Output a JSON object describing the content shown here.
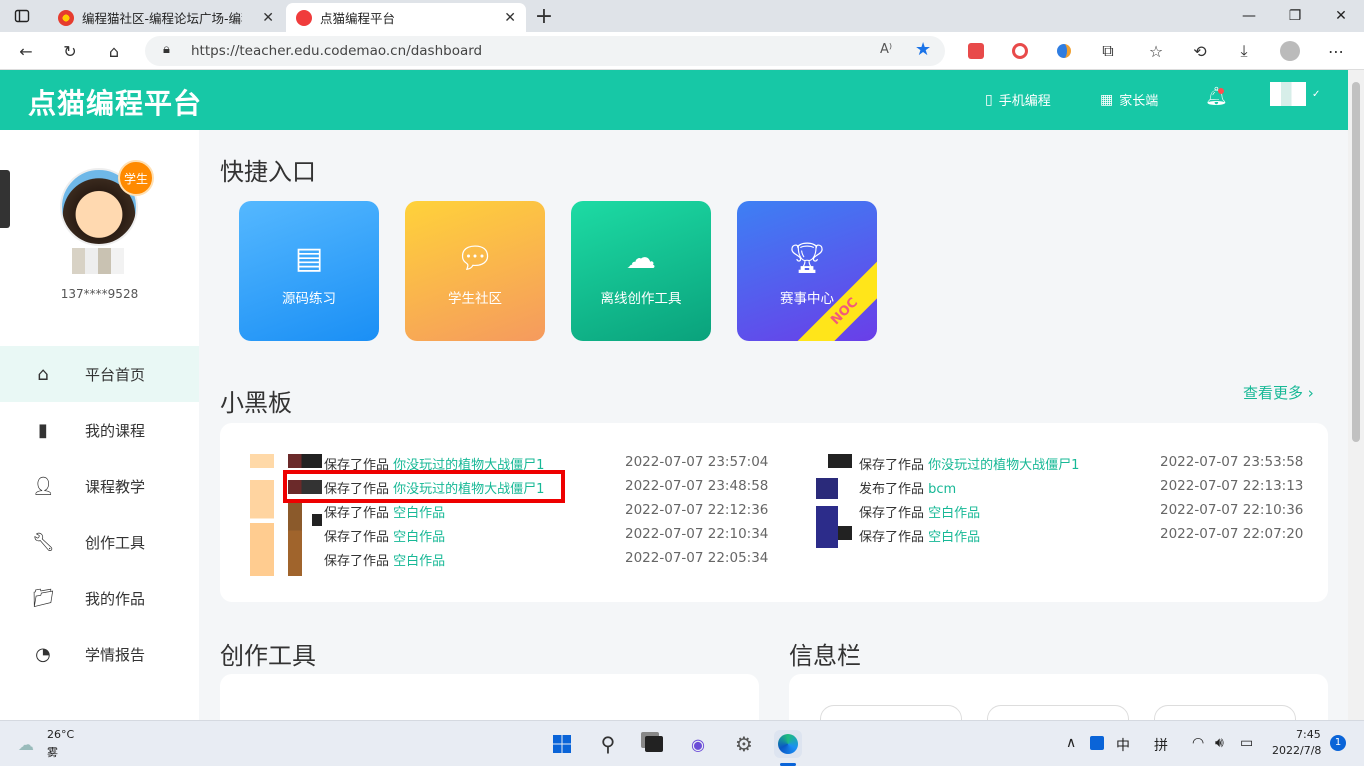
{
  "browser": {
    "tabs": [
      {
        "label": "编程猫社区-编程论坛广场-编程爱",
        "active": false
      },
      {
        "label": "点猫编程平台",
        "active": true
      }
    ],
    "url": "https://teacher.edu.codemao.cn/dashboard",
    "icons": [
      "sidebar-toggle-icon",
      "back-icon",
      "reload-icon",
      "home-icon",
      "lock-icon",
      "read-aloud-icon",
      "favorite-star-icon",
      "extension-icon",
      "collections-icon",
      "history-icon",
      "download-icon",
      "profile-icon",
      "more-icon"
    ]
  },
  "header": {
    "logo": "点猫编程平台",
    "mobile": "手机编程",
    "parent": "家长端"
  },
  "sidebar": {
    "badge": "学生",
    "phone": "137****9528",
    "items": [
      {
        "label": "平台首页",
        "icon": "home-icon",
        "active": true
      },
      {
        "label": "我的课程",
        "icon": "book-icon",
        "active": false
      },
      {
        "label": "课程教学",
        "icon": "teacher-icon",
        "active": false
      },
      {
        "label": "创作工具",
        "icon": "wrench-icon",
        "active": false
      },
      {
        "label": "我的作品",
        "icon": "folder-icon",
        "active": false
      },
      {
        "label": "学情报告",
        "icon": "pie-chart-icon",
        "active": false
      }
    ]
  },
  "quick": {
    "title": "快捷入口",
    "cards": [
      {
        "label": "源码练习",
        "color1": "#4fb3ff",
        "color2": "#1a8ff5"
      },
      {
        "label": "学生社区",
        "color1": "#ffcf3f",
        "color2": "#f59e5c"
      },
      {
        "label": "离线创作工具",
        "color1": "#19d8a0",
        "color2": "#0aa57e"
      },
      {
        "label": "赛事中心",
        "color1": "#3d7cf4",
        "color2": "#6a3ee8",
        "ribbon": "NOC"
      }
    ]
  },
  "board": {
    "title": "小黑板",
    "more": "查看更多",
    "left": [
      {
        "action": "保存了作品",
        "work": "你没玩过的植物大战僵尸1",
        "time": "2022-07-07 23:57:04"
      },
      {
        "action": "保存了作品",
        "work": "你没玩过的植物大战僵尸1",
        "time": "2022-07-07 23:48:58"
      },
      {
        "action": "保存了作品",
        "work": "空白作品",
        "time": "2022-07-07 22:12:36"
      },
      {
        "action": "保存了作品",
        "work": "空白作品",
        "time": "2022-07-07 22:10:34"
      },
      {
        "action": "保存了作品",
        "work": "空白作品",
        "time": "2022-07-07 22:05:34"
      }
    ],
    "right": [
      {
        "action": "保存了作品",
        "work": "你没玩过的植物大战僵尸1",
        "time": "2022-07-07 23:53:58"
      },
      {
        "action": "发布了作品",
        "work": "bcm",
        "time": "2022-07-07 22:13:13"
      },
      {
        "action": "保存了作品",
        "work": "空白作品",
        "time": "2022-07-07 22:10:36"
      },
      {
        "action": "保存了作品",
        "work": "空白作品",
        "time": "2022-07-07 22:07:20"
      }
    ]
  },
  "tools_title": "创作工具",
  "info_title": "信息栏",
  "taskbar": {
    "temp": "26°C",
    "weather": "雾",
    "ime1": "中",
    "ime2": "拼",
    "time": "7:45",
    "date": "2022/7/8",
    "notify": "1"
  }
}
